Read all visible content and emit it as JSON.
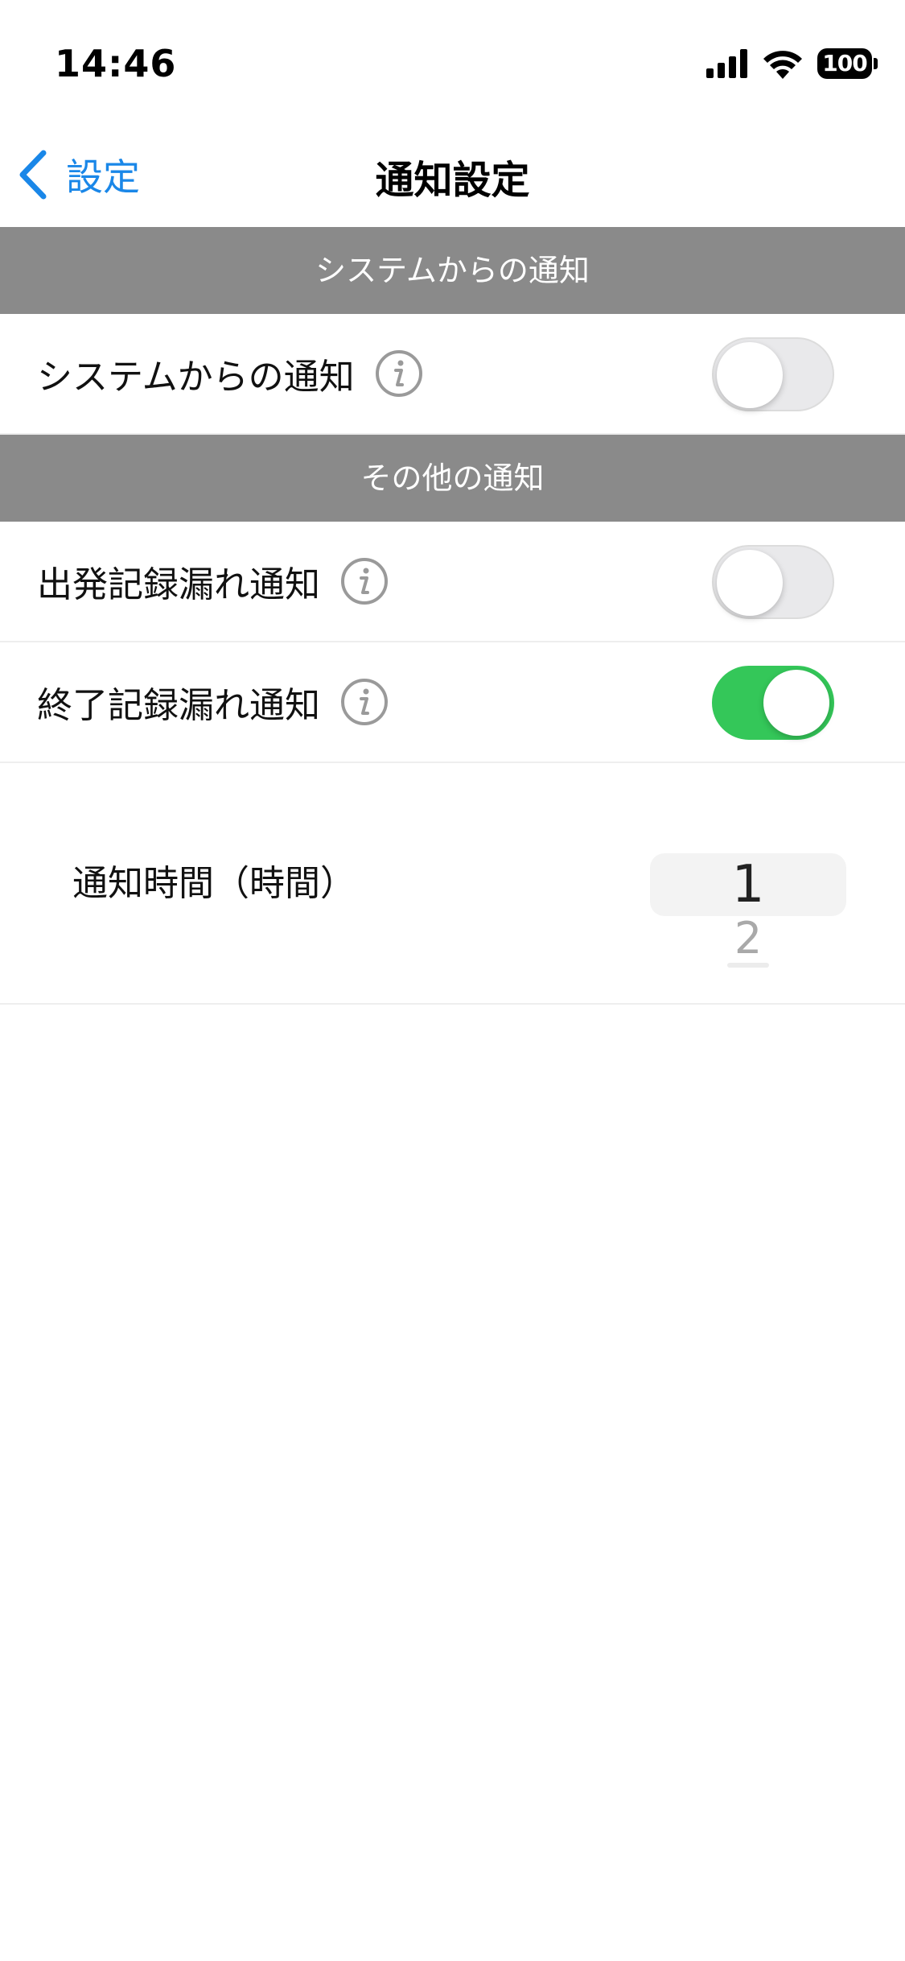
{
  "status_bar": {
    "time": "14:46",
    "battery": "100",
    "icons": [
      "signal-icon",
      "wifi-icon",
      "battery-icon"
    ]
  },
  "nav": {
    "back_label": "設定",
    "title": "通知設定",
    "accent_color": "#1a87e8"
  },
  "sections": [
    {
      "header": "システムからの通知",
      "rows": [
        {
          "label": "システムからの通知",
          "toggle": false
        }
      ]
    },
    {
      "header": "その他の通知",
      "rows": [
        {
          "label": "出発記録漏れ通知",
          "toggle": false
        },
        {
          "label": "終了記録漏れ通知",
          "toggle": true
        }
      ]
    }
  ],
  "picker": {
    "label": "通知時間（時間）",
    "selected": "1",
    "next": "2"
  },
  "colors": {
    "section_header_bg": "#8a8a8a",
    "toggle_on": "#34c759",
    "toggle_off": "#e9e9eb"
  }
}
